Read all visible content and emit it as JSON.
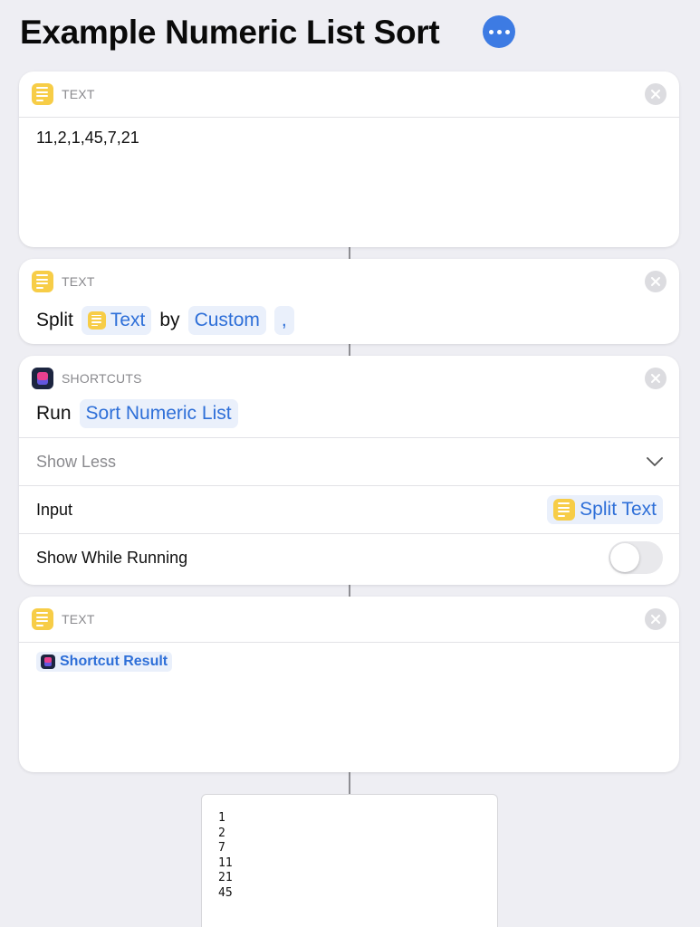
{
  "header": {
    "title": "Example Numeric List Sort"
  },
  "cards": {
    "text1": {
      "kind": "TEXT",
      "value": "11,2,1,45,7,21"
    },
    "split": {
      "kind": "TEXT",
      "word_split": "Split",
      "token_text": "Text",
      "word_by": "by",
      "token_custom": "Custom",
      "token_separator": ","
    },
    "run": {
      "kind": "SHORTCUTS",
      "word_run": "Run",
      "token_shortcut": "Sort Numeric List",
      "show_less": "Show Less",
      "input_label": "Input",
      "input_value": "Split Text",
      "show_while_running_label": "Show While Running",
      "show_while_running_on": false
    },
    "text2": {
      "kind": "TEXT",
      "result_token": "Shortcut Result"
    }
  },
  "output": {
    "lines": [
      "1",
      "2",
      "7",
      "11",
      "21",
      "45"
    ]
  },
  "colors": {
    "accent": "#3d7be3",
    "token_text": "#2e6fd8",
    "text_icon": "#f7cd47"
  }
}
